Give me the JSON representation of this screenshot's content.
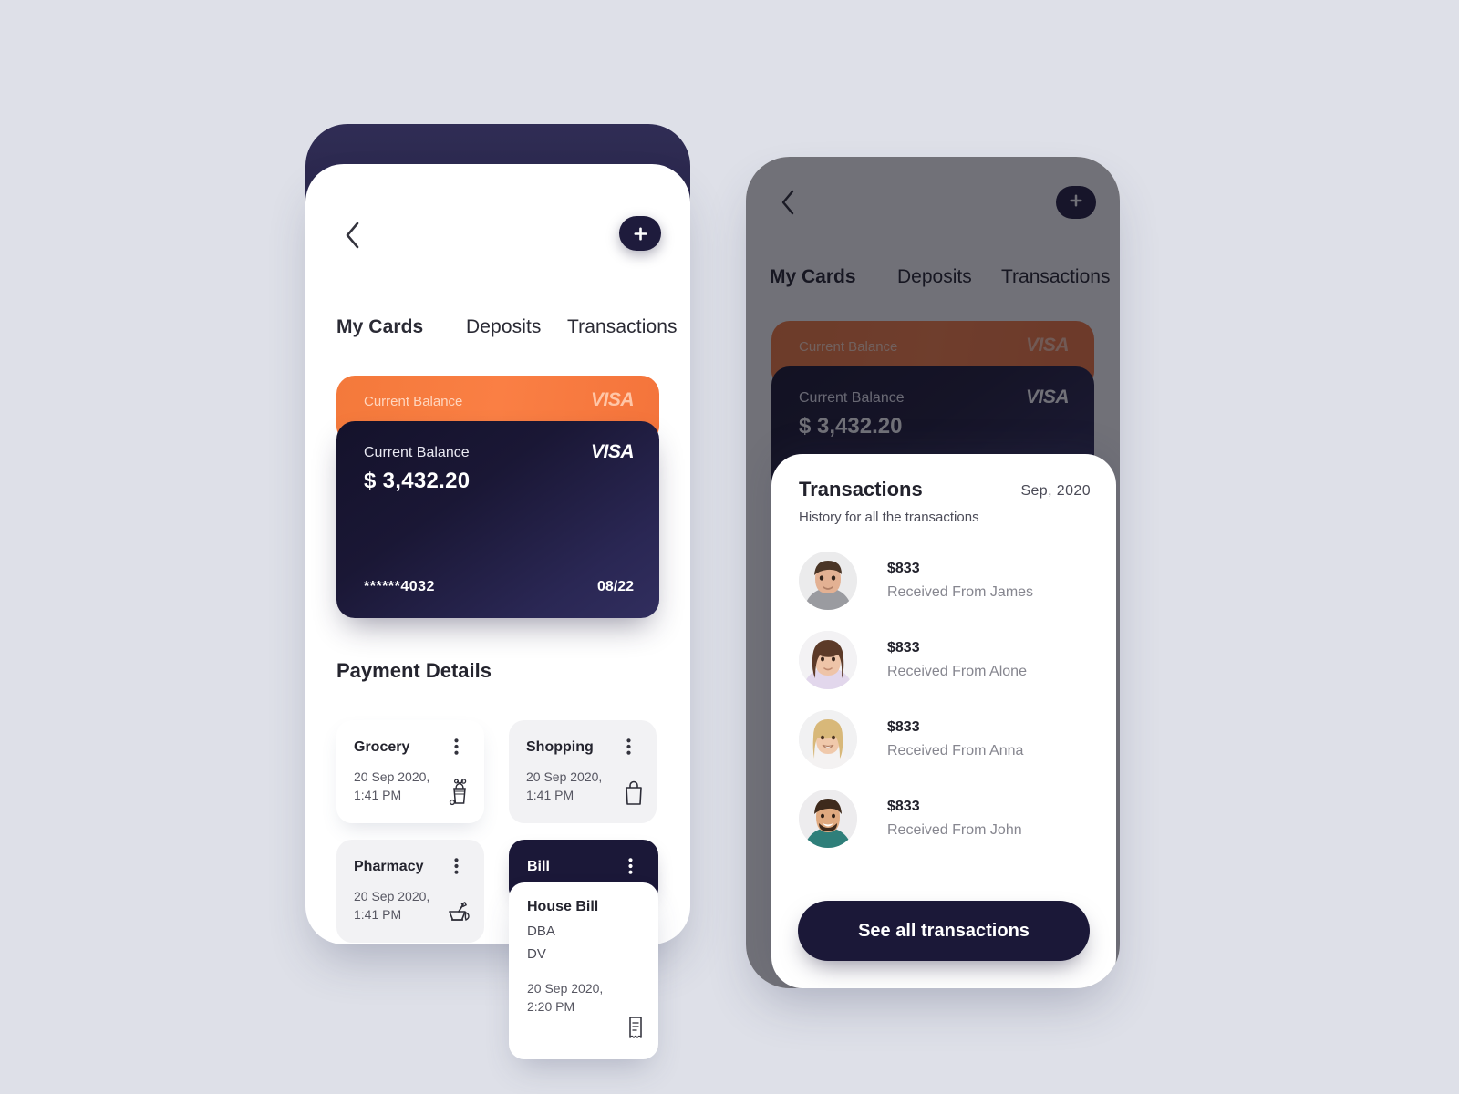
{
  "background_color": "#dee0e8",
  "accent_orange": "#f97a3d",
  "accent_dark": "#1b1838",
  "phone_left": {
    "nav": {
      "back_icon": "chevron-left-icon",
      "add_icon": "plus-icon",
      "add_label": "+"
    },
    "tabs": [
      {
        "label": "My Cards",
        "active": true
      },
      {
        "label": "Deposits",
        "active": false
      },
      {
        "label": "Transactions",
        "active": false
      }
    ],
    "card_back": {
      "balance_label": "Current Balance",
      "brand": "VISA"
    },
    "card_front": {
      "balance_label": "Current Balance",
      "balance_amount": "$ 3,432.20",
      "card_number": "******4032",
      "expiry": "08/22",
      "brand": "VISA"
    },
    "payment_details": {
      "title": "Payment Details",
      "tiles": [
        {
          "name": "Grocery",
          "date": "20 Sep 2020,",
          "time": "1:41 PM",
          "icon": "grocery-bag-icon"
        },
        {
          "name": "Shopping",
          "date": "20 Sep 2020,",
          "time": "1:41 PM",
          "icon": "shopping-bag-icon"
        },
        {
          "name": "Pharmacy",
          "date": "20 Sep 2020,",
          "time": "1:41 PM",
          "icon": "mortar-pestle-icon"
        }
      ],
      "bill": {
        "name": "Bill",
        "menu_icon": "kebab-menu-icon",
        "detail_title": "House Bill",
        "detail_line1": "DBA",
        "detail_line2": "DV",
        "date": "20 Sep 2020,",
        "time": "2:20 PM",
        "icon": "receipt-icon"
      }
    }
  },
  "phone_right": {
    "nav": {
      "back_icon": "chevron-left-icon",
      "add_label": "+"
    },
    "tabs": [
      {
        "label": "My Cards",
        "active": true
      },
      {
        "label": "Deposits",
        "active": false
      },
      {
        "label": "Transactions",
        "active": false
      }
    ],
    "card_back": {
      "balance_label": "Current Balance",
      "brand": "VISA"
    },
    "card_front": {
      "balance_label": "Current Balance",
      "balance_amount": "$ 3,432.20",
      "brand": "VISA"
    },
    "sheet": {
      "title": "Transactions",
      "month": "Sep, 2020",
      "subtitle": "History for all the transactions",
      "transactions": [
        {
          "amount": "$833",
          "description": "Received From James",
          "avatar": "avatar-james"
        },
        {
          "amount": "$833",
          "description": "Received From Alone",
          "avatar": "avatar-alone"
        },
        {
          "amount": "$833",
          "description": "Received From Anna",
          "avatar": "avatar-anna"
        },
        {
          "amount": "$833",
          "description": "Received From John",
          "avatar": "avatar-john"
        }
      ],
      "cta_label": "See all transactions"
    }
  }
}
